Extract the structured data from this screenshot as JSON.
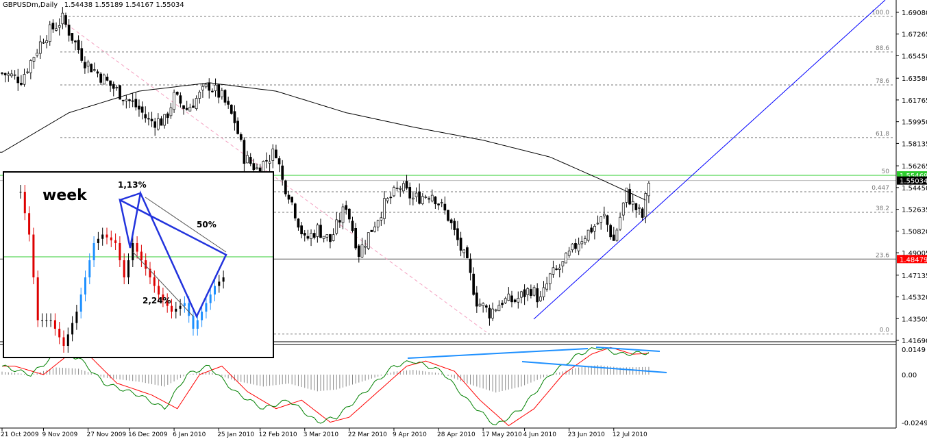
{
  "header": {
    "symbol": "GBPUSDm,Daily",
    "ohlc": "1.54438 1.55189 1.54167 1.55034"
  },
  "chart_data": {
    "type": "candlestick",
    "price_axis": {
      "min": 1.4169,
      "max": 1.6908,
      "ticks": [
        "1.69080",
        "1.67265",
        "1.65450",
        "1.63580",
        "1.61765",
        "1.59950",
        "1.58135",
        "1.56265",
        "1.54450",
        "1.52635",
        "1.50820",
        "1.49005",
        "1.47135",
        "1.45320",
        "1.43505",
        "1.41690"
      ]
    },
    "price_labels": [
      {
        "text": "1.55469",
        "value": 1.55469,
        "color": "#2ecc2e"
      },
      {
        "text": "1.55034",
        "value": 1.55034,
        "color": "#000000"
      },
      {
        "text": "1.48479",
        "value": 1.48479,
        "color": "#ff0000"
      }
    ],
    "date_labels": [
      {
        "bar": 0,
        "text": "21 Oct 2009"
      },
      {
        "bar": 13,
        "text": "9 Nov 2009"
      },
      {
        "bar": 27,
        "text": "27 Nov 2009"
      },
      {
        "bar": 40,
        "text": "16 Dec 2009"
      },
      {
        "bar": 54,
        "text": "6 Jan 2010"
      },
      {
        "bar": 68,
        "text": "25 Jan 2010"
      },
      {
        "bar": 81,
        "text": "12 Feb 2010"
      },
      {
        "bar": 95,
        "text": "3 Mar 2010"
      },
      {
        "bar": 109,
        "text": "22 Mar 2010"
      },
      {
        "bar": 123,
        "text": "9 Apr 2010"
      },
      {
        "bar": 137,
        "text": "28 Apr 2010"
      },
      {
        "bar": 151,
        "text": "17 May 2010"
      },
      {
        "bar": 164,
        "text": "4 Jun 2010"
      },
      {
        "bar": 178,
        "text": "23 Jun 2010"
      },
      {
        "bar": 192,
        "text": "12 Jul 2010"
      }
    ],
    "close_anchors": [
      [
        0,
        1.64
      ],
      [
        6,
        1.635
      ],
      [
        13,
        1.67
      ],
      [
        19,
        1.685
      ],
      [
        26,
        1.65
      ],
      [
        34,
        1.63
      ],
      [
        43,
        1.61
      ],
      [
        46,
        1.6
      ],
      [
        51,
        1.6
      ],
      [
        54,
        1.62
      ],
      [
        58,
        1.61
      ],
      [
        65,
        1.63
      ],
      [
        69,
        1.62
      ],
      [
        73,
        1.6
      ],
      [
        76,
        1.57
      ],
      [
        80,
        1.56
      ],
      [
        86,
        1.575
      ],
      [
        88,
        1.55
      ],
      [
        90,
        1.54
      ],
      [
        95,
        1.5
      ],
      [
        99,
        1.51
      ],
      [
        103,
        1.5
      ],
      [
        108,
        1.53
      ],
      [
        112,
        1.49
      ],
      [
        116,
        1.51
      ],
      [
        120,
        1.53
      ],
      [
        125,
        1.545
      ],
      [
        129,
        1.535
      ],
      [
        135,
        1.54
      ],
      [
        140,
        1.52
      ],
      [
        143,
        1.5
      ],
      [
        146,
        1.48
      ],
      [
        149,
        1.45
      ],
      [
        153,
        1.44
      ],
      [
        157,
        1.45
      ],
      [
        161,
        1.45
      ],
      [
        166,
        1.46
      ],
      [
        169,
        1.45
      ],
      [
        172,
        1.47
      ],
      [
        176,
        1.48
      ],
      [
        181,
        1.5
      ],
      [
        185,
        1.51
      ],
      [
        189,
        1.52
      ],
      [
        192,
        1.5
      ],
      [
        196,
        1.54
      ],
      [
        198,
        1.53
      ],
      [
        201,
        1.52
      ],
      [
        203,
        1.55
      ]
    ],
    "ma_anchors": [
      [
        0,
        1.574
      ],
      [
        21,
        1.607
      ],
      [
        43,
        1.625
      ],
      [
        65,
        1.632
      ],
      [
        86,
        1.625
      ],
      [
        108,
        1.607
      ],
      [
        129,
        1.595
      ],
      [
        151,
        1.584
      ],
      [
        172,
        1.57
      ],
      [
        189,
        1.55
      ],
      [
        202,
        1.534
      ]
    ],
    "fibo_levels": [
      {
        "label": "100.0",
        "value": 1.6874
      },
      {
        "label": "88.6",
        "value": 1.6577
      },
      {
        "label": "78.6",
        "value": 1.6302
      },
      {
        "label": "61.8",
        "value": 1.5862
      },
      {
        "label": "50",
        "value": 1.5547
      },
      {
        "label": "0.447",
        "value": 1.541
      },
      {
        "label": "38.2",
        "value": 1.5238
      },
      {
        "label": "23.6",
        "value": 1.4848
      },
      {
        "label": "0.0",
        "value": 1.4222
      }
    ],
    "indicator": {
      "ticks": [
        "0.0149",
        "0.00",
        "-0.0249"
      ],
      "anchors": [
        [
          0,
          0.005
        ],
        [
          9,
          0.0
        ],
        [
          17,
          0.012
        ],
        [
          24,
          0.01
        ],
        [
          32,
          -0.005
        ],
        [
          43,
          -0.012
        ],
        [
          51,
          -0.02
        ],
        [
          58,
          0.0
        ],
        [
          65,
          0.005
        ],
        [
          73,
          -0.01
        ],
        [
          82,
          -0.02
        ],
        [
          90,
          -0.015
        ],
        [
          99,
          -0.028
        ],
        [
          105,
          -0.025
        ],
        [
          114,
          -0.01
        ],
        [
          123,
          0.005
        ],
        [
          129,
          0.008
        ],
        [
          138,
          0.002
        ],
        [
          146,
          -0.015
        ],
        [
          155,
          -0.03
        ],
        [
          163,
          -0.02
        ],
        [
          172,
          0.0
        ],
        [
          181,
          0.012
        ],
        [
          187,
          0.016
        ],
        [
          194,
          0.012
        ],
        [
          203,
          0.013
        ]
      ]
    },
    "inset": {
      "label": "week",
      "annotations": [
        "1,13%",
        "50%",
        "2,24%"
      ]
    }
  }
}
